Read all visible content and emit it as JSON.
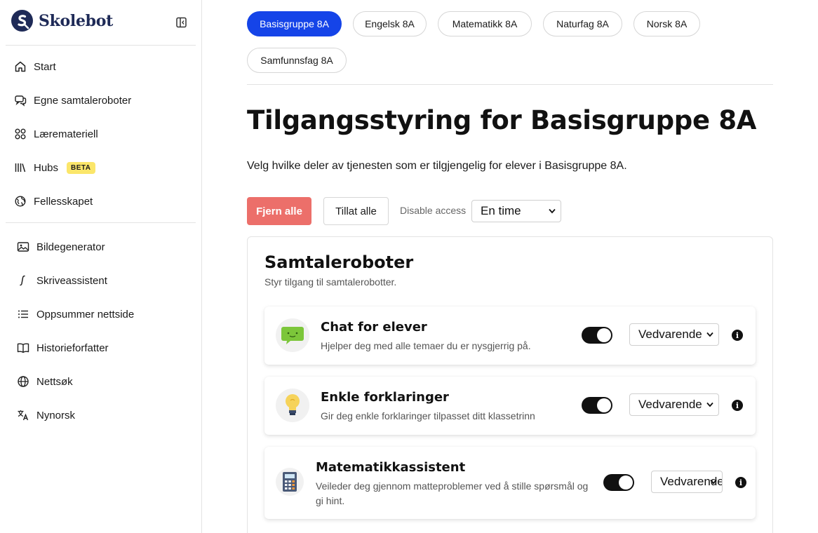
{
  "brand": {
    "name": "Skolebot",
    "logo_letter": "S",
    "color": "#1e2a57"
  },
  "sidebar": {
    "primary": [
      {
        "label": "Start",
        "icon": "home-icon"
      },
      {
        "label": "Egne samtaleroboter",
        "icon": "chat-bubbles-icon"
      },
      {
        "label": "Læremateriell",
        "icon": "grid-circles-icon"
      },
      {
        "label": "Hubs",
        "icon": "library-icon",
        "badge": "BETA"
      },
      {
        "label": "Fellesskapet",
        "icon": "globe-icon"
      }
    ],
    "tools": [
      {
        "label": "Bildegenerator",
        "icon": "image-icon"
      },
      {
        "label": "Skriveassistent",
        "icon": "italic-cursor-icon"
      },
      {
        "label": "Oppsummer nettside",
        "icon": "list-icon"
      },
      {
        "label": "Historieforfatter",
        "icon": "book-icon"
      },
      {
        "label": "Nettsøk",
        "icon": "web-globe-icon"
      },
      {
        "label": "Nynorsk",
        "icon": "translate-icon"
      }
    ]
  },
  "groups": [
    {
      "label": "Basisgruppe 8A",
      "active": true
    },
    {
      "label": "Engelsk 8A",
      "active": false
    },
    {
      "label": "Matematikk 8A",
      "active": false
    },
    {
      "label": "Naturfag 8A",
      "active": false
    },
    {
      "label": "Norsk 8A",
      "active": false
    },
    {
      "label": "Samfunnsfag 8A",
      "active": false
    }
  ],
  "page": {
    "title": "Tilgangsstyring for Basisgruppe 8A",
    "description": "Velg hvilke deler av tjenesten som er tilgjengelig for elever i Basisgruppe 8A."
  },
  "actions": {
    "remove_all": "Fjern alle",
    "allow_all": "Tillat alle",
    "disable_label": "Disable access",
    "disable_value": "En time"
  },
  "section": {
    "title": "Samtaleroboter",
    "subtitle": "Styr tilgang til samtalerobotter.",
    "bots": [
      {
        "name": "Chat for elever",
        "desc": "Hjelper deg med alle temaer du er nysgjerrig på.",
        "enabled": true,
        "duration": "Vedvarende",
        "icon": "green-chat-icon"
      },
      {
        "name": "Enkle forklaringer",
        "desc": "Gir deg enkle forklaringer tilpasset ditt klassetrinn",
        "enabled": true,
        "duration": "Vedvarende",
        "icon": "lightbulb-icon"
      },
      {
        "name": "Matematikkassistent",
        "desc": "Veileder deg gjennom matteproblemer ved å stille spørsmål og gi hint.",
        "enabled": true,
        "duration": "Vedvarende",
        "icon": "calculator-icon"
      }
    ]
  },
  "colors": {
    "accent": "#1544e8",
    "danger": "#ec6f6a",
    "badge": "#fbe66a"
  }
}
